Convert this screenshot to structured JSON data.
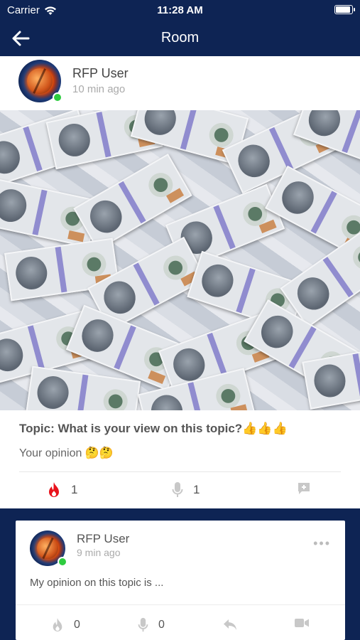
{
  "status_bar": {
    "carrier": "Carrier",
    "time": "11:28 AM"
  },
  "nav": {
    "title": "Room",
    "back_icon": "arrow-left-icon"
  },
  "post": {
    "username": "RFP User",
    "time_ago": "10 min ago",
    "image": "money-bills-photo",
    "topic_text": "Topic: What is your view on this topic?",
    "topic_emoji": "👍👍👍",
    "opinion_text": "Your opinion",
    "opinion_emoji": "🤔🤔",
    "fire_count": "1",
    "mic_count": "1",
    "colors": {
      "fire": "#e8131c",
      "online": "#2ecc40",
      "nav_bg": "#0e2454",
      "icon_gray": "#c8c8c8"
    }
  },
  "comment": {
    "username": "RFP User",
    "time_ago": "9 min ago",
    "more_label": "•••",
    "body": "My opinion on this topic is ...",
    "fire_count": "0",
    "mic_count": "0"
  }
}
